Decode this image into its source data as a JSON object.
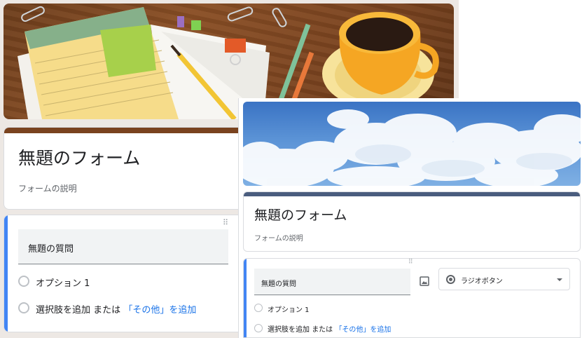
{
  "back_form": {
    "title": "無題のフォーム",
    "description": "フォームの説明",
    "question": {
      "title": "無題の質問",
      "option1": "オプション 1",
      "add_option": "選択肢を追加",
      "or_text": "または",
      "add_other": "「その他」を追加"
    },
    "accent_color": "#7a431f"
  },
  "front_form": {
    "title": "無題のフォーム",
    "description": "フォームの説明",
    "question": {
      "title": "無題の質問",
      "type": "ラジオボタン",
      "option1": "オプション 1",
      "add_option": "選択肢を追加",
      "or_text": "または",
      "add_other": "「その他」を追加"
    },
    "accent_color": "#4a5d7e"
  },
  "icons": {
    "drag_handle": "⠿",
    "image": "image-icon",
    "dropdown": "chevron-down-icon"
  }
}
